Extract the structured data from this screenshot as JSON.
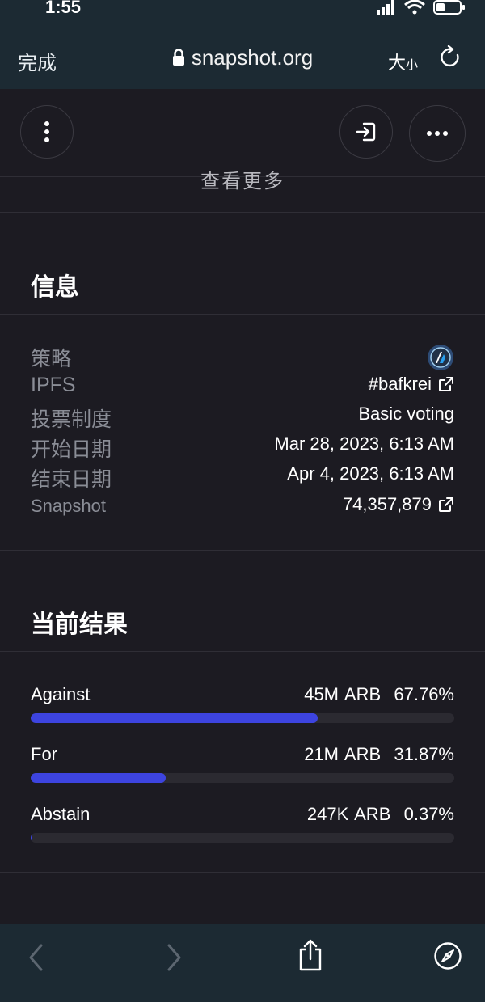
{
  "status_bar": {
    "time": "1:55"
  },
  "browser": {
    "done_label": "完成",
    "url": "snapshot.org",
    "text_size_big": "大",
    "text_size_small": "小"
  },
  "page": {
    "see_more": "查看更多",
    "info": {
      "title": "信息",
      "rows": [
        {
          "label": "策略",
          "value": ""
        },
        {
          "label": "IPFS",
          "value": "#bafkrei"
        },
        {
          "label": "投票制度",
          "value": "Basic voting"
        },
        {
          "label": "开始日期",
          "value": "Mar 28, 2023, 6:13 AM"
        },
        {
          "label": "结束日期",
          "value": "Apr 4, 2023, 6:13 AM"
        },
        {
          "label": "Snapshot",
          "value": "74,357,879"
        }
      ]
    },
    "results": {
      "title": "当前结果",
      "items": [
        {
          "label": "Against",
          "amount": "45M ARB",
          "percent_text": "67.76%",
          "percent": 67.76
        },
        {
          "label": "For",
          "amount": "21M ARB",
          "percent_text": "31.87%",
          "percent": 31.87
        },
        {
          "label": "Abstain",
          "amount": "247K ARB",
          "percent_text": "0.37%",
          "percent": 0.37
        }
      ]
    }
  },
  "colors": {
    "background": "#1c1b22",
    "chrome": "#1c2a33",
    "accent_bar": "#3d44e0",
    "muted_label": "#8a8d96"
  },
  "icons": [
    "signal-icon",
    "wifi-icon",
    "battery-icon",
    "lock-icon",
    "reload-icon",
    "menu-dots-vertical-icon",
    "login-icon",
    "more-horizontal-icon",
    "arbitrum-logo-icon",
    "external-link-icon",
    "back-icon",
    "forward-icon",
    "share-icon",
    "compass-icon"
  ]
}
